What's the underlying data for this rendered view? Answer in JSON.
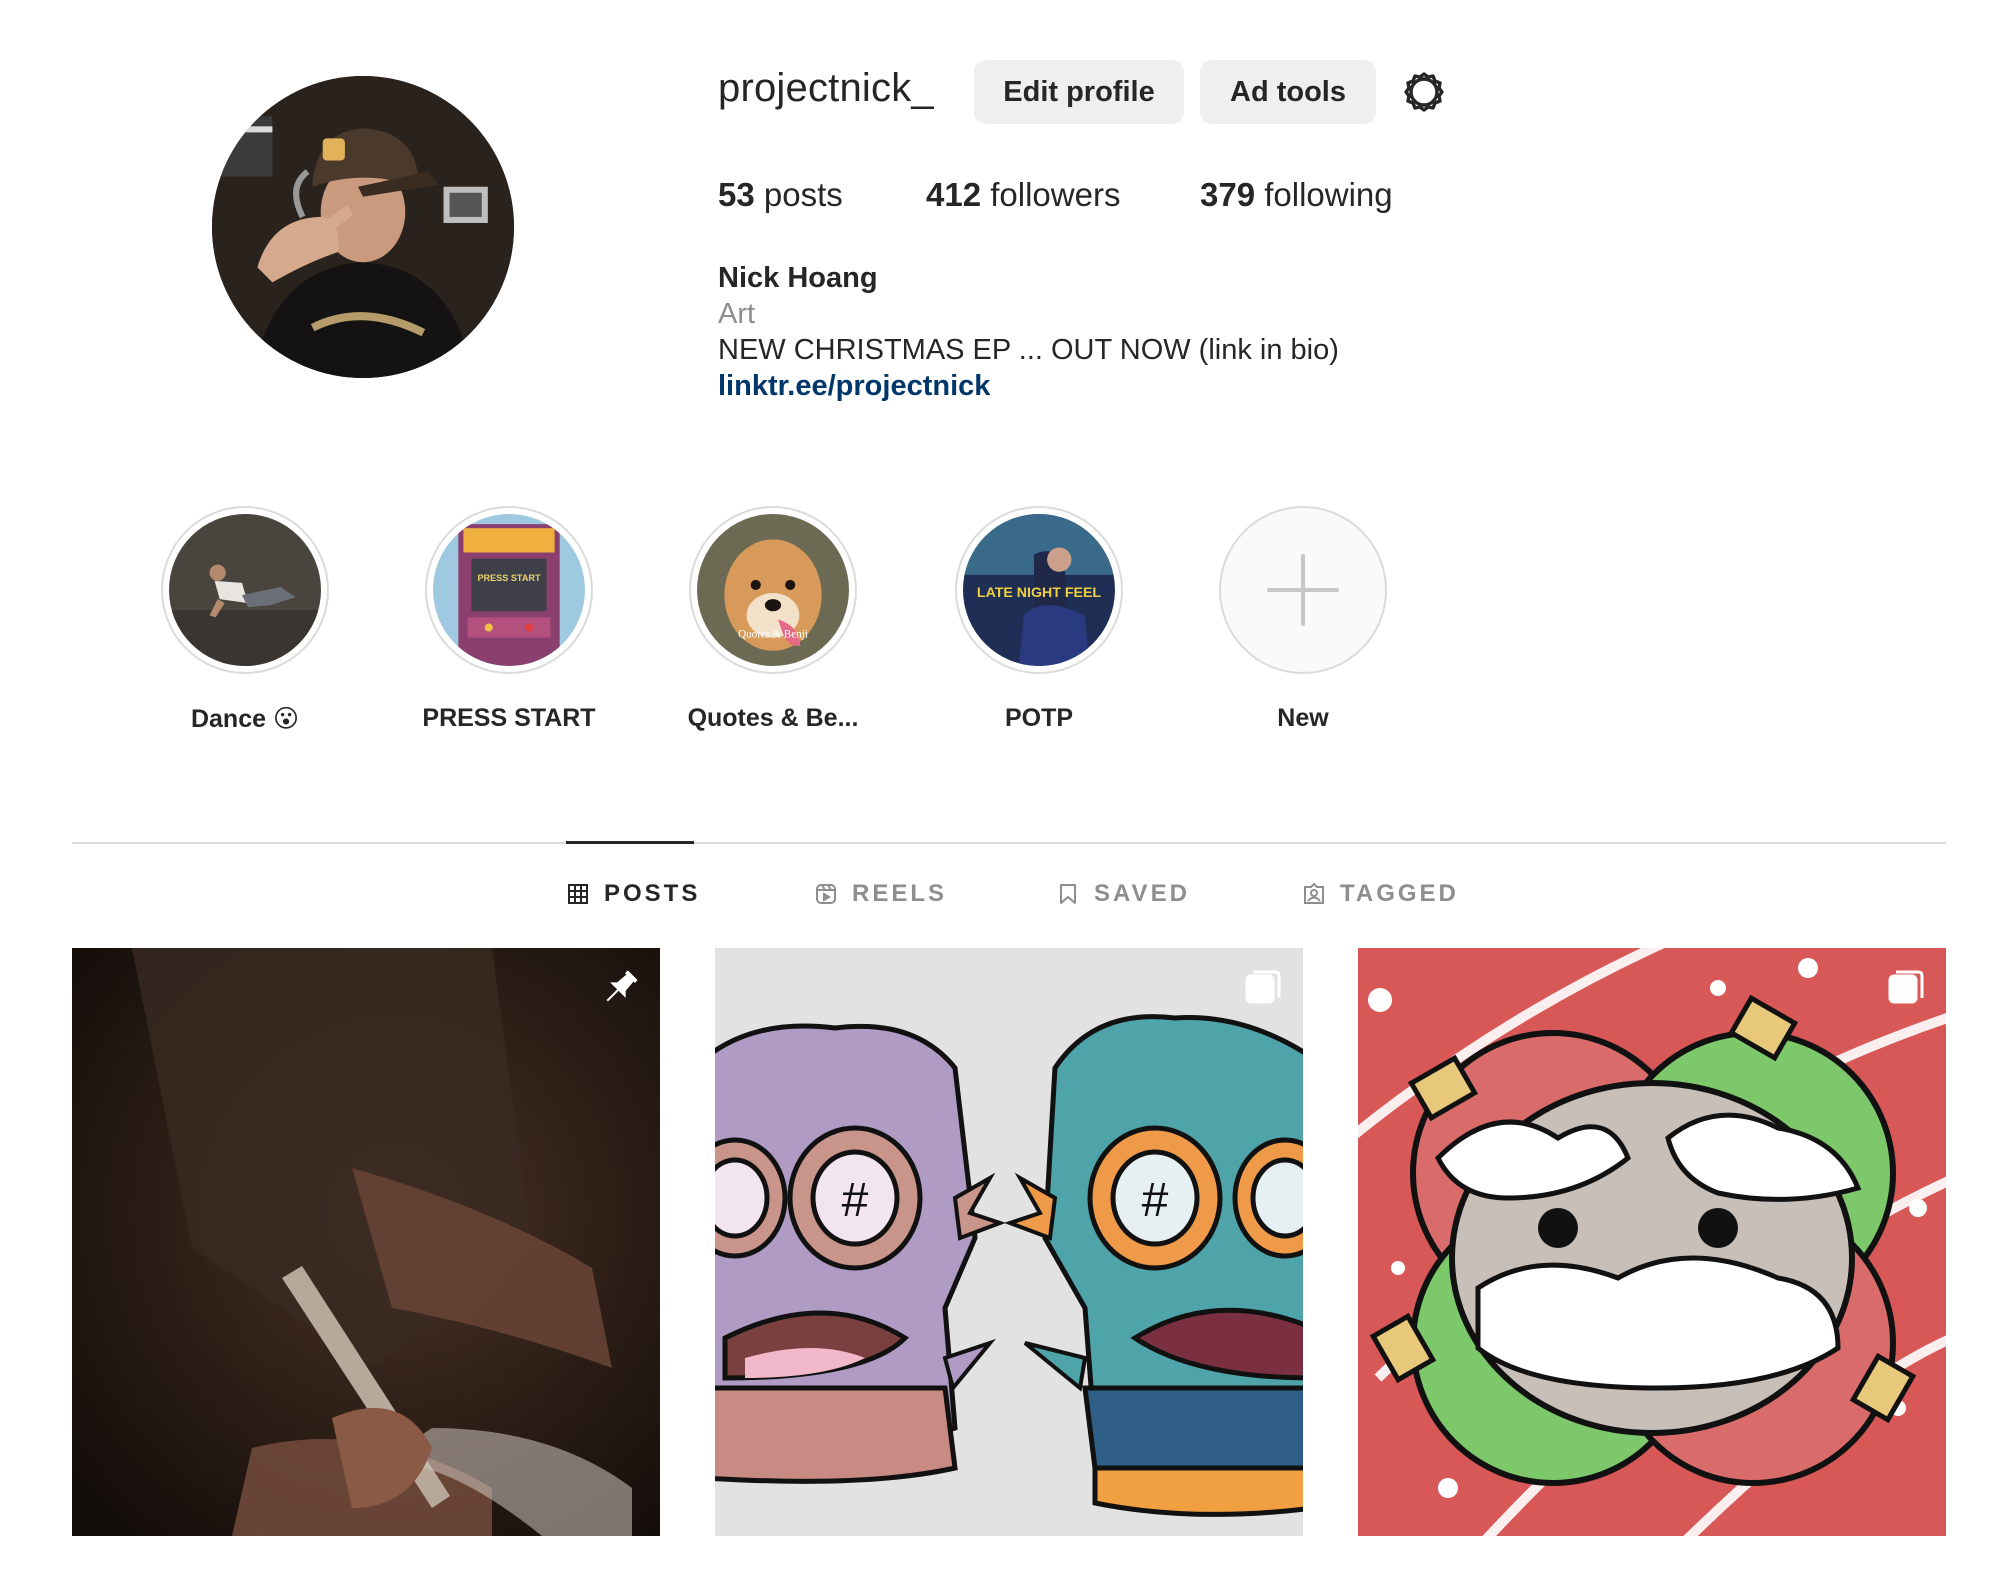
{
  "profile": {
    "username": "projectnick_",
    "edit_profile_label": "Edit profile",
    "ad_tools_label": "Ad tools",
    "settings_icon": "gear-icon",
    "stats": {
      "posts_count": "53",
      "posts_label": "posts",
      "followers_count": "412",
      "followers_label": "followers",
      "following_count": "379",
      "following_label": "following"
    },
    "bio": {
      "name": "Nick Hoang",
      "category": "Art",
      "text": "NEW CHRISTMAS EP ... OUT NOW (link in bio)",
      "link": "linktr.ee/projectnick"
    }
  },
  "highlights": [
    {
      "label": "Dance 😮"
    },
    {
      "label": "PRESS START",
      "art_text": "PRESS START"
    },
    {
      "label": "Quotes & Be...",
      "art_text": "Quotes & Benji"
    },
    {
      "label": "POTP",
      "art_text": "LATE NIGHT FEEL"
    },
    {
      "label": "New",
      "icon": "plus-icon"
    }
  ],
  "tabs": [
    {
      "label": "POSTS",
      "icon": "grid-icon",
      "active": true
    },
    {
      "label": "REELS",
      "icon": "reels-icon",
      "active": false
    },
    {
      "label": "SAVED",
      "icon": "bookmark-icon",
      "active": false
    },
    {
      "label": "TAGGED",
      "icon": "tagged-icon",
      "active": false
    }
  ],
  "posts": [
    {
      "badge": "pin-icon",
      "description": "pinned-video"
    },
    {
      "badge": "carousel-icon",
      "description": "character-art"
    },
    {
      "badge": "carousel-icon",
      "description": "christmas-art"
    }
  ],
  "colors": {
    "text_primary": "#262626",
    "text_secondary": "#8e8e8e",
    "link": "#00376b",
    "button_bg": "#efefef",
    "divider": "#dbdbdb"
  }
}
